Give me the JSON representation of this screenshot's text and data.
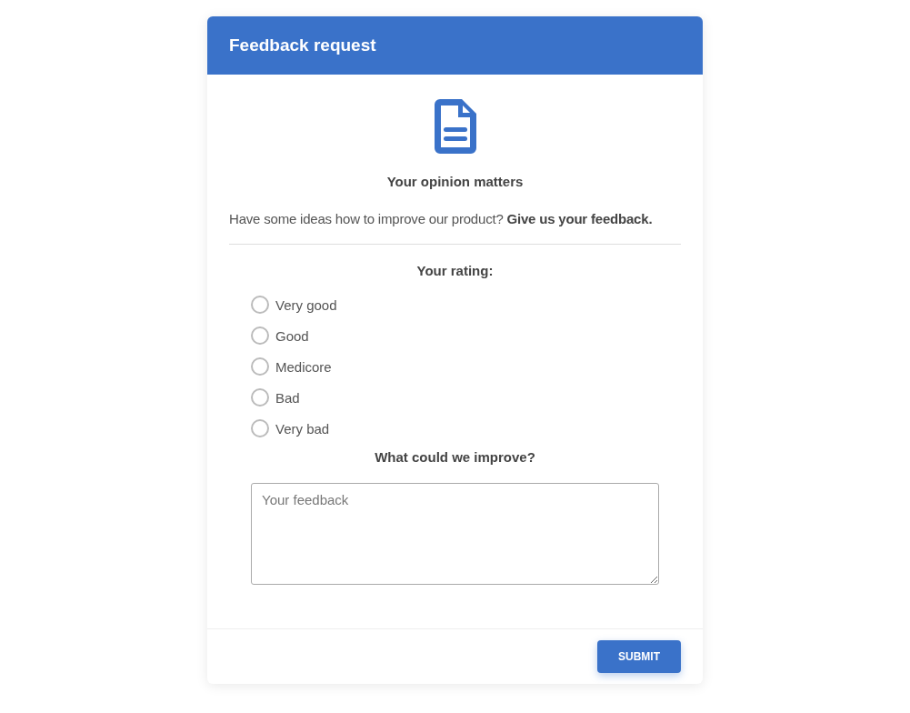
{
  "header": {
    "title": "Feedback request"
  },
  "heading": "Your opinion matters",
  "intro": "Have some ideas how to improve our product? **Give us your feedback.**",
  "rating": {
    "label": "Your rating:",
    "options": [
      {
        "label": "Very good",
        "selected": false
      },
      {
        "label": "Good",
        "selected": false
      },
      {
        "label": "Medicore",
        "selected": false
      },
      {
        "label": "Bad",
        "selected": false
      },
      {
        "label": "Very bad",
        "selected": false
      }
    ]
  },
  "improve": {
    "label": "What could we improve?",
    "placeholder": "Your feedback"
  },
  "submit": "SUBMIT"
}
